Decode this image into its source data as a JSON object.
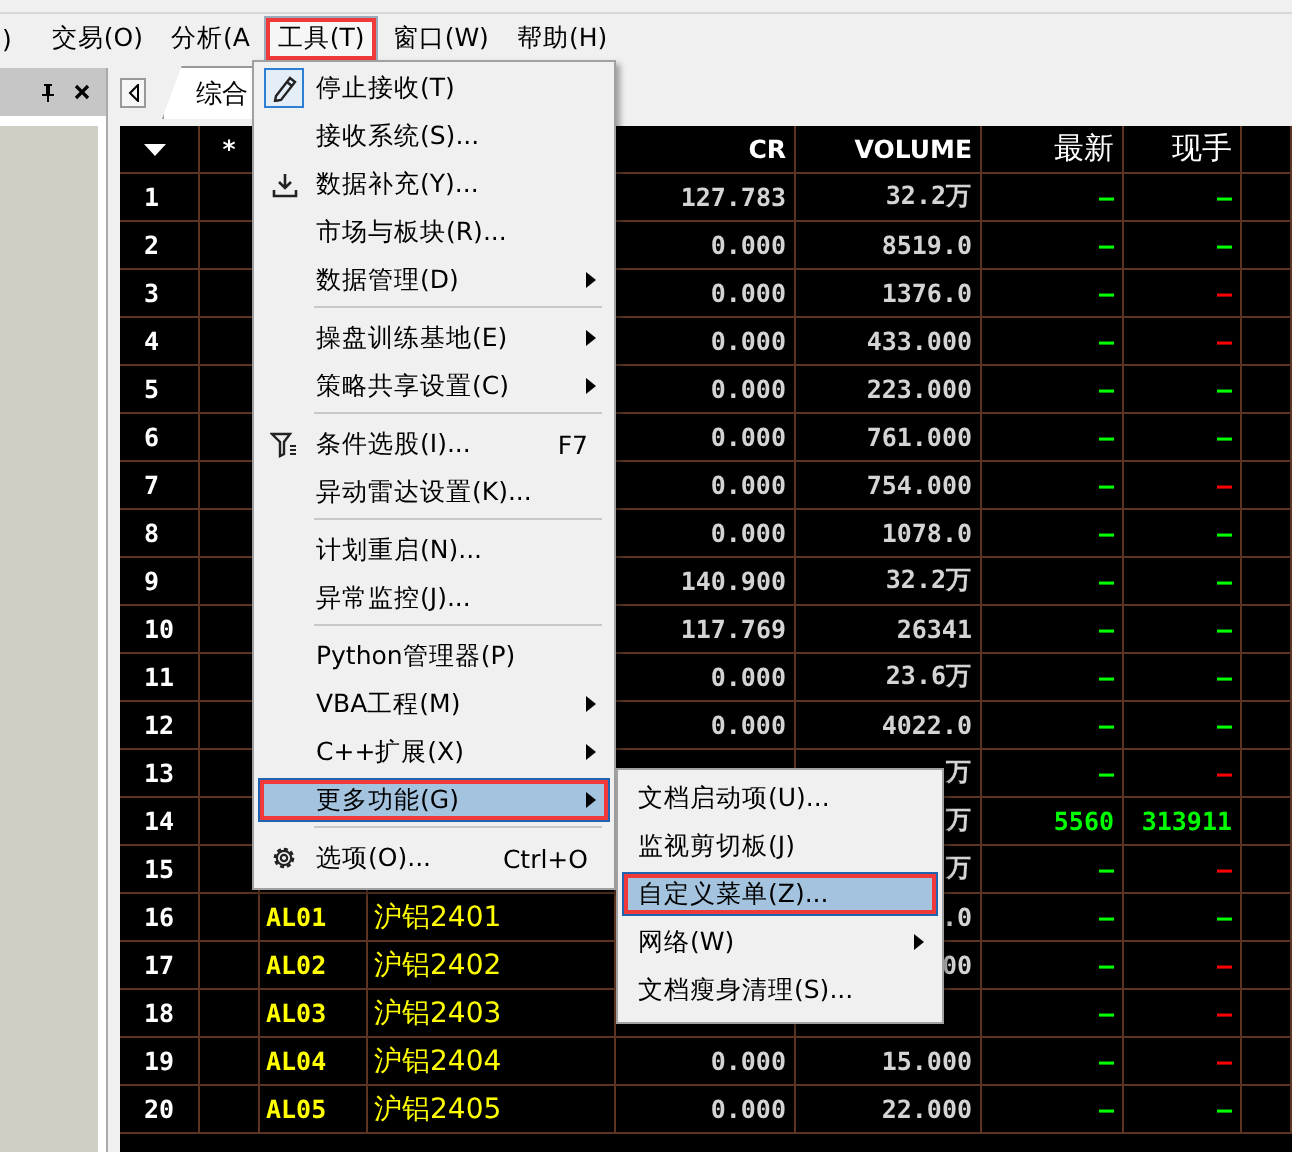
{
  "menubar": {
    "items": [
      {
        "label": ")",
        "selected": false,
        "annotated": false
      },
      {
        "label": "交易(O)",
        "selected": false,
        "annotated": false
      },
      {
        "label": "分析(A",
        "selected": false,
        "annotated": false
      },
      {
        "label": "工具(T)",
        "selected": true,
        "annotated": true
      },
      {
        "label": "窗口(W)",
        "selected": false,
        "annotated": false
      },
      {
        "label": "帮助(H)",
        "selected": false,
        "annotated": false
      }
    ]
  },
  "tabs": [
    {
      "label": "综合",
      "selected": true
    }
  ],
  "grid": {
    "columns": [
      {},
      {
        "label": "*"
      },
      {},
      {},
      {
        "label": "CR"
      },
      {
        "label": "VOLUME"
      },
      {
        "label": "最新"
      },
      {
        "label": "现手"
      },
      {}
    ],
    "rows": [
      {
        "num": "1",
        "cr": "127.783",
        "volume": "32.2万",
        "latest": {
          "text": "—",
          "color": "#00ff00"
        },
        "current": {
          "text": "—",
          "color": "#00ff00"
        }
      },
      {
        "num": "2",
        "cr": "0.000",
        "volume": "8519.0",
        "latest": {
          "text": "—",
          "color": "#00ff00"
        },
        "current": {
          "text": "—",
          "color": "#00ff00"
        }
      },
      {
        "num": "3",
        "cr": "0.000",
        "volume": "1376.0",
        "latest": {
          "text": "—",
          "color": "#00ff00"
        },
        "current": {
          "text": "—",
          "color": "#ff0000"
        }
      },
      {
        "num": "4",
        "cr": "0.000",
        "volume": "433.000",
        "latest": {
          "text": "—",
          "color": "#00ff00"
        },
        "current": {
          "text": "—",
          "color": "#ff0000"
        }
      },
      {
        "num": "5",
        "cr": "0.000",
        "volume": "223.000",
        "latest": {
          "text": "—",
          "color": "#00ff00"
        },
        "current": {
          "text": "—",
          "color": "#00ff00"
        }
      },
      {
        "num": "6",
        "cr": "0.000",
        "volume": "761.000",
        "latest": {
          "text": "—",
          "color": "#00ff00"
        },
        "current": {
          "text": "—",
          "color": "#00ff00"
        }
      },
      {
        "num": "7",
        "cr": "0.000",
        "volume": "754.000",
        "latest": {
          "text": "—",
          "color": "#00ff00"
        },
        "current": {
          "text": "—",
          "color": "#ff0000"
        }
      },
      {
        "num": "8",
        "cr": "0.000",
        "volume": "1078.0",
        "latest": {
          "text": "—",
          "color": "#00ff00"
        },
        "current": {
          "text": "—",
          "color": "#00ff00"
        }
      },
      {
        "num": "9",
        "cr": "140.900",
        "volume": "32.2万",
        "latest": {
          "text": "—",
          "color": "#00ff00"
        },
        "current": {
          "text": "—",
          "color": "#00ff00"
        }
      },
      {
        "num": "10",
        "cr": "117.769",
        "volume": "26341",
        "latest": {
          "text": "—",
          "color": "#00ff00"
        },
        "current": {
          "text": "—",
          "color": "#00ff00"
        }
      },
      {
        "num": "11",
        "cr": "0.000",
        "volume": "23.6万",
        "latest": {
          "text": "—",
          "color": "#00ff00"
        },
        "current": {
          "text": "—",
          "color": "#00ff00"
        }
      },
      {
        "num": "12",
        "cr": "0.000",
        "volume": "4022.0",
        "latest": {
          "text": "—",
          "color": "#00ff00"
        },
        "current": {
          "text": "—",
          "color": "#00ff00"
        }
      },
      {
        "num": "13",
        "volume": "万",
        "latest": {
          "text": "—",
          "color": "#00ff00"
        },
        "current": {
          "text": "—",
          "color": "#ff0000"
        }
      },
      {
        "num": "14",
        "volume": "万",
        "latest": {
          "text": "5560",
          "color": "#00ff00"
        },
        "current": {
          "text": "313911",
          "color": "#00ff00"
        }
      },
      {
        "num": "15",
        "volume": "万",
        "latest": {
          "text": "—",
          "color": "#00ff00"
        },
        "current": {
          "text": "—",
          "color": "#ff0000"
        }
      },
      {
        "num": "16",
        "code": "AL01",
        "name": "沪铝2401",
        "volume": ".0",
        "latest": {
          "text": "—",
          "color": "#00ff00"
        },
        "current": {
          "text": "—",
          "color": "#00ff00"
        }
      },
      {
        "num": "17",
        "code": "AL02",
        "name": "沪铝2402",
        "volume": "00",
        "latest": {
          "text": "—",
          "color": "#00ff00"
        },
        "current": {
          "text": "—",
          "color": "#ff0000"
        }
      },
      {
        "num": "18",
        "code": "AL03",
        "name": "沪铝2403",
        "latest": {
          "text": "—",
          "color": "#00ff00"
        },
        "current": {
          "text": "—",
          "color": "#ff0000"
        }
      },
      {
        "num": "19",
        "code": "AL04",
        "name": "沪铝2404",
        "cr": "0.000",
        "volume": "15.000",
        "latest": {
          "text": "—",
          "color": "#00ff00"
        },
        "current": {
          "text": "—",
          "color": "#ff0000"
        }
      },
      {
        "num": "20",
        "code": "AL05",
        "name": "沪铝2405",
        "cr": "0.000",
        "volume": "22.000",
        "latest": {
          "text": "—",
          "color": "#00ff00"
        },
        "current": {
          "text": "—",
          "color": "#00ff00"
        }
      }
    ]
  },
  "menu": {
    "items": [
      {
        "kind": "item",
        "label": "停止接收(T)",
        "checked": true,
        "selected": false,
        "submenu": false,
        "annotated": false
      },
      {
        "kind": "item",
        "label": "接收系统(S)...",
        "checked": false,
        "selected": false,
        "submenu": false,
        "annotated": false
      },
      {
        "kind": "item",
        "label": "数据补充(Y)...",
        "checked": false,
        "selected": false,
        "submenu": false,
        "annotated": false
      },
      {
        "kind": "item",
        "label": "市场与板块(R)...",
        "checked": false,
        "selected": false,
        "submenu": false,
        "annotated": false
      },
      {
        "kind": "item",
        "label": "数据管理(D)",
        "checked": false,
        "selected": false,
        "submenu": true,
        "annotated": false
      },
      {
        "kind": "separator"
      },
      {
        "kind": "item",
        "label": "操盘训练基地(E)",
        "checked": false,
        "selected": false,
        "submenu": true,
        "annotated": false
      },
      {
        "kind": "item",
        "label": "策略共享设置(C)",
        "checked": false,
        "selected": false,
        "submenu": true,
        "annotated": false
      },
      {
        "kind": "separator"
      },
      {
        "kind": "item",
        "label": "条件选股(I)...",
        "shortcut": "F7",
        "checked": false,
        "selected": false,
        "submenu": false,
        "annotated": false
      },
      {
        "kind": "item",
        "label": "异动雷达设置(K)...",
        "checked": false,
        "selected": false,
        "submenu": false,
        "annotated": false
      },
      {
        "kind": "separator"
      },
      {
        "kind": "item",
        "label": "计划重启(N)...",
        "checked": false,
        "selected": false,
        "submenu": false,
        "annotated": false
      },
      {
        "kind": "item",
        "label": "异常监控(J)...",
        "checked": false,
        "selected": false,
        "submenu": false,
        "annotated": false
      },
      {
        "kind": "separator"
      },
      {
        "kind": "item",
        "label": "Python管理器(P)",
        "checked": false,
        "selected": false,
        "submenu": false,
        "annotated": false
      },
      {
        "kind": "item",
        "label": "VBA工程(M)",
        "checked": false,
        "selected": false,
        "submenu": true,
        "annotated": false
      },
      {
        "kind": "item",
        "label": "C++扩展(X)",
        "checked": false,
        "selected": false,
        "submenu": true,
        "annotated": false
      },
      {
        "kind": "item",
        "label": "更多功能(G)",
        "checked": false,
        "selected": true,
        "submenu": true,
        "annotated": true
      },
      {
        "kind": "separator"
      },
      {
        "kind": "item",
        "label": "选项(O)...",
        "shortcut": "Ctrl+O",
        "checked": false,
        "selected": false,
        "submenu": false,
        "annotated": false
      }
    ]
  },
  "submenu": {
    "items": [
      {
        "label": "文档启动项(U)...",
        "selected": false,
        "submenu": false,
        "annotated": false
      },
      {
        "label": "监视剪切板(J)",
        "selected": false,
        "submenu": false,
        "annotated": false
      },
      {
        "label": "自定义菜单(Z)...",
        "selected": true,
        "submenu": false,
        "annotated": true
      },
      {
        "label": "网络(W)",
        "selected": false,
        "submenu": true,
        "annotated": false
      },
      {
        "label": "文档瘦身清理(S)...",
        "selected": false,
        "submenu": false,
        "annotated": false
      }
    ]
  }
}
